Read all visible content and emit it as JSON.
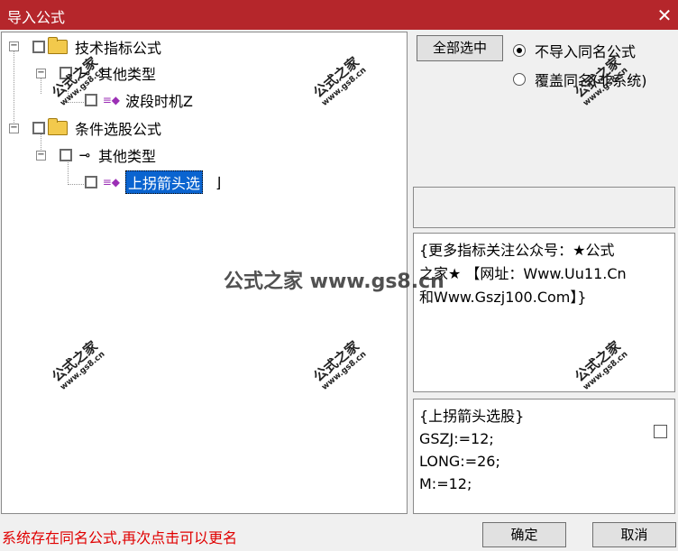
{
  "window": {
    "title": "导入公式",
    "close_glyph": "✕"
  },
  "tree": {
    "nodes": [
      {
        "label": "技术指标公式",
        "expander": "−"
      },
      {
        "label": "其他类型",
        "expander": "−"
      },
      {
        "label": "波段时机Z"
      },
      {
        "label": "条件选股公式",
        "expander": "−"
      },
      {
        "label": "其他类型",
        "expander": "−"
      },
      {
        "label": "上拐箭头选"
      }
    ]
  },
  "toolbar": {
    "select_all_label": "全部选中"
  },
  "import_options": [
    {
      "label": "不导入同名公式",
      "selected": true
    },
    {
      "label": "覆盖同名(非系统)",
      "selected": false
    }
  ],
  "description": {
    "lines": [
      "{更多指标关注公众号：★公式",
      "之家★ 【网址：Www.Uu11.Cn",
      "和Www.Gszj100.Com】}"
    ]
  },
  "code": {
    "lines": [
      "{上拐箭头选股}",
      "GSZJ:=12;",
      "LONG:=26;",
      "M:=12;"
    ]
  },
  "status_message": "系统存在同名公式,再次点击可以更名",
  "buttons": {
    "ok_label": "确定",
    "cancel_label": "取消"
  },
  "watermark": {
    "text": "公式之家",
    "url": "www.gs8.cn",
    "center": "公式之家 www.gs8.cn"
  },
  "colors": {
    "title_bar": "#b5262b",
    "selection": "#0a64d0",
    "status_text": "#e00000"
  }
}
